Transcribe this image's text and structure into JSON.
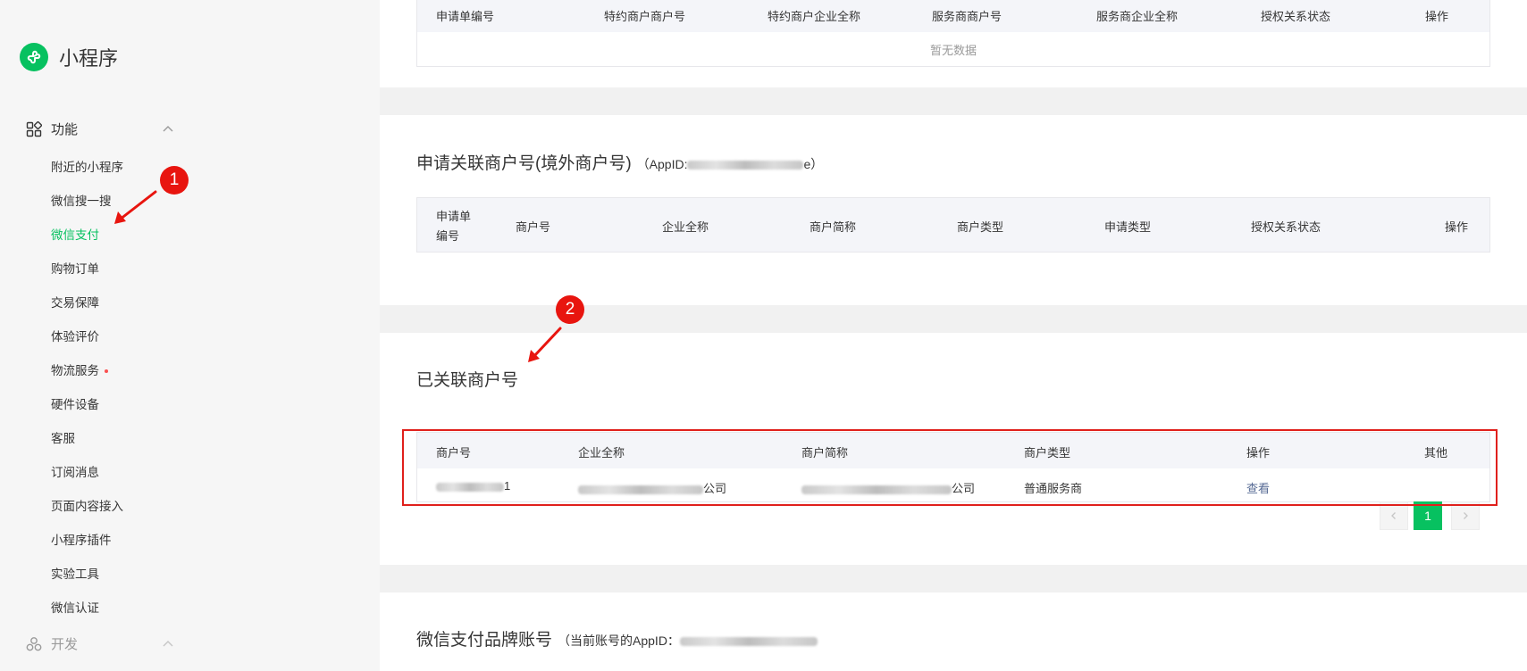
{
  "app": {
    "title": "小程序"
  },
  "sidebar": {
    "sections": [
      {
        "label": "功能"
      },
      {
        "label": "开发"
      }
    ],
    "items": [
      {
        "label": "附近的小程序"
      },
      {
        "label": "微信搜一搜"
      },
      {
        "label": "微信支付"
      },
      {
        "label": "购物订单"
      },
      {
        "label": "交易保障"
      },
      {
        "label": "体验评价"
      },
      {
        "label": "物流服务"
      },
      {
        "label": "硬件设备"
      },
      {
        "label": "客服"
      },
      {
        "label": "订阅消息"
      },
      {
        "label": "页面内容接入"
      },
      {
        "label": "小程序插件"
      },
      {
        "label": "实验工具"
      },
      {
        "label": "微信认证"
      }
    ],
    "active_item": "微信支付"
  },
  "card_special": {
    "columns": [
      "申请单编号",
      "特约商户商户号",
      "特约商户企业全称",
      "服务商商户号",
      "服务商企业全称",
      "授权关系状态",
      "操作"
    ],
    "empty_text": "暂无数据"
  },
  "card_overseas": {
    "title": "申请关联商户号(境外商户号)",
    "appid_prefix": "（AppID:",
    "appid_suffix": "e）",
    "columns": [
      "申请单编号",
      "商户号",
      "企业全称",
      "商户简称",
      "商户类型",
      "申请类型",
      "授权关系状态",
      "操作"
    ],
    "col0_line1": "申请单",
    "col0_line2": "编号"
  },
  "card_linked": {
    "title": "已关联商户号",
    "columns": [
      "商户号",
      "企业全称",
      "商户简称",
      "商户类型",
      "操作",
      "其他"
    ],
    "rows": [
      {
        "merchant_id_tail": "1",
        "company_suffix": "公司",
        "short_suffix": "公司",
        "type": "普通服务商",
        "action": "查看"
      }
    ],
    "pagination": {
      "current": "1"
    }
  },
  "card_brand": {
    "title": "微信支付品牌账号",
    "sub": "（当前账号的AppID："
  },
  "annotations": {
    "badge1": "1",
    "badge2": "2"
  },
  "colors": {
    "accent": "#07c160",
    "link": "#576b95",
    "annotation_red": "#e8150f"
  }
}
